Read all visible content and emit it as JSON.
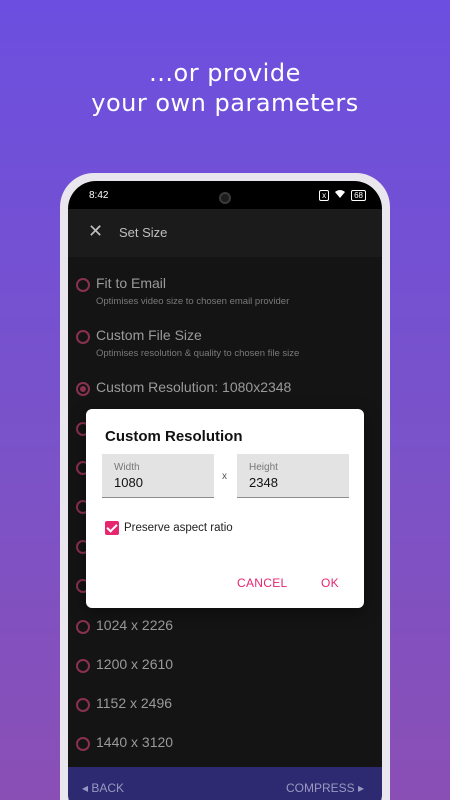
{
  "headline": {
    "line1": "...or provide",
    "line2": "your own parameters"
  },
  "status": {
    "time": "8:42",
    "battery": "68",
    "sim": "x"
  },
  "appbar": {
    "close": "✕",
    "title": "Set Size"
  },
  "options": [
    {
      "label": "Fit to Email",
      "sub": "Optimises video size to chosen email provider",
      "selected": false
    },
    {
      "label": "Custom File Size",
      "sub": "Optimises resolution & quality to chosen file size",
      "selected": false
    },
    {
      "label": "Custom Resolution: 1080x2348",
      "sub": "",
      "selected": true
    },
    {
      "label": "",
      "sub": "",
      "selected": false
    },
    {
      "label": "",
      "sub": "",
      "selected": false
    },
    {
      "label": "",
      "sub": "",
      "selected": false
    },
    {
      "label": "",
      "sub": "",
      "selected": false
    },
    {
      "label": "",
      "sub": "",
      "selected": false
    },
    {
      "label": "1024 x 2226",
      "sub": "",
      "selected": false
    },
    {
      "label": "1200 x 2610",
      "sub": "",
      "selected": false
    },
    {
      "label": "1152 x 2496",
      "sub": "",
      "selected": false
    },
    {
      "label": "1440 x 3120",
      "sub": "",
      "selected": false
    }
  ],
  "bottombar": {
    "back": "◂  BACK",
    "compress": "COMPRESS  ▸"
  },
  "dialog": {
    "title": "Custom Resolution",
    "width_label": "Width",
    "width_value": "1080",
    "times": "x",
    "height_label": "Height",
    "height_value": "2348",
    "preserve_label": "Preserve aspect ratio",
    "preserve_checked": true,
    "cancel": "CANCEL",
    "ok": "OK"
  },
  "colors": {
    "accent": "#e6266e",
    "background_top": "#6c4fe0",
    "bottombar": "#2d2a72"
  }
}
